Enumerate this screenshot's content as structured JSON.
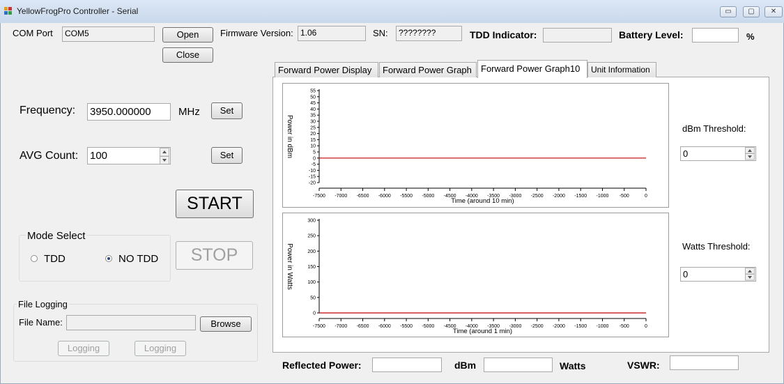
{
  "window": {
    "title": "YellowFrogPro Controller - Serial",
    "controls": {
      "minimize": "▭",
      "maximize": "▢",
      "close": "✕"
    }
  },
  "top": {
    "com_port_label": "COM Port",
    "com_port_value": "COM5",
    "open_label": "Open",
    "close_label": "Close",
    "firmware_label": "Firmware Version:",
    "firmware_value": "1.06",
    "sn_label": "SN:",
    "sn_value": "????????",
    "tdd_indicator_label": "TDD Indicator:",
    "tdd_indicator_value": "",
    "battery_label": "Battery Level:",
    "battery_value": "",
    "battery_unit": "%"
  },
  "controls": {
    "frequency_label": "Frequency:",
    "frequency_value": "3950.000000",
    "frequency_unit": "MHz",
    "frequency_set": "Set",
    "avg_count_label": "AVG Count:",
    "avg_count_value": "100",
    "avg_set": "Set",
    "start_label": "START",
    "stop_label": "STOP"
  },
  "mode_select": {
    "title": "Mode Select",
    "options": [
      {
        "label": "TDD",
        "selected": false
      },
      {
        "label": "NO TDD",
        "selected": true
      }
    ]
  },
  "file_logging": {
    "title": "File Logging",
    "file_name_label": "File Name:",
    "file_name_value": "",
    "browse_label": "Browse",
    "logging_button_1": "Logging",
    "logging_button_2": "Logging"
  },
  "tabs": [
    {
      "label": "Forward Power Display",
      "selected": false
    },
    {
      "label": "Forward Power Graph",
      "selected": false
    },
    {
      "label": "Forward Power Graph10",
      "selected": true
    },
    {
      "label": "Unit Information",
      "selected": false
    }
  ],
  "thresholds": {
    "dbm_label": "dBm Threshold:",
    "dbm_value": "0",
    "watts_label": "Watts Threshold:",
    "watts_value": "0"
  },
  "bottom": {
    "reflected_label": "Reflected Power:",
    "reflected_dbm_value": "",
    "dbm_unit": "dBm",
    "reflected_watts_value": "",
    "watts_unit": "Watts",
    "vswr_label": "VSWR:",
    "vswr_value": ""
  },
  "colors": {
    "series_line": "#c00000",
    "window_bg": "#f0f0f0",
    "titlebar": "#c9d9ec"
  },
  "chart_data": [
    {
      "type": "line",
      "ylabel": "Power in dBm",
      "xlabel": "Time (around 10 min)",
      "x_ticks": [
        -7500,
        -7000,
        -6500,
        -6000,
        -5500,
        -5000,
        -4500,
        -4000,
        -3500,
        -3000,
        -2500,
        -2000,
        -1500,
        -1000,
        -500,
        0
      ],
      "y_ticks": [
        55,
        50,
        45,
        40,
        35,
        30,
        25,
        20,
        15,
        10,
        5,
        0,
        -5,
        -10,
        -15,
        -20
      ],
      "xlim": [
        -7500,
        0
      ],
      "ylim": [
        -20,
        55
      ],
      "series": [
        {
          "x": [
            -7500,
            0
          ],
          "y": [
            0,
            0
          ]
        }
      ]
    },
    {
      "type": "line",
      "ylabel": "Power in Watts",
      "xlabel": "Time (around 1 min)",
      "x_ticks": [
        -7500,
        -7000,
        -6500,
        -6000,
        -5500,
        -5000,
        -4500,
        -4000,
        -3500,
        -3000,
        -2500,
        -2000,
        -1500,
        -1000,
        -500,
        0
      ],
      "y_ticks": [
        300,
        250,
        200,
        150,
        100,
        50,
        0
      ],
      "xlim": [
        -7500,
        0
      ],
      "ylim": [
        0,
        300
      ],
      "series": [
        {
          "x": [
            -7500,
            0
          ],
          "y": [
            0,
            0
          ]
        }
      ]
    }
  ]
}
